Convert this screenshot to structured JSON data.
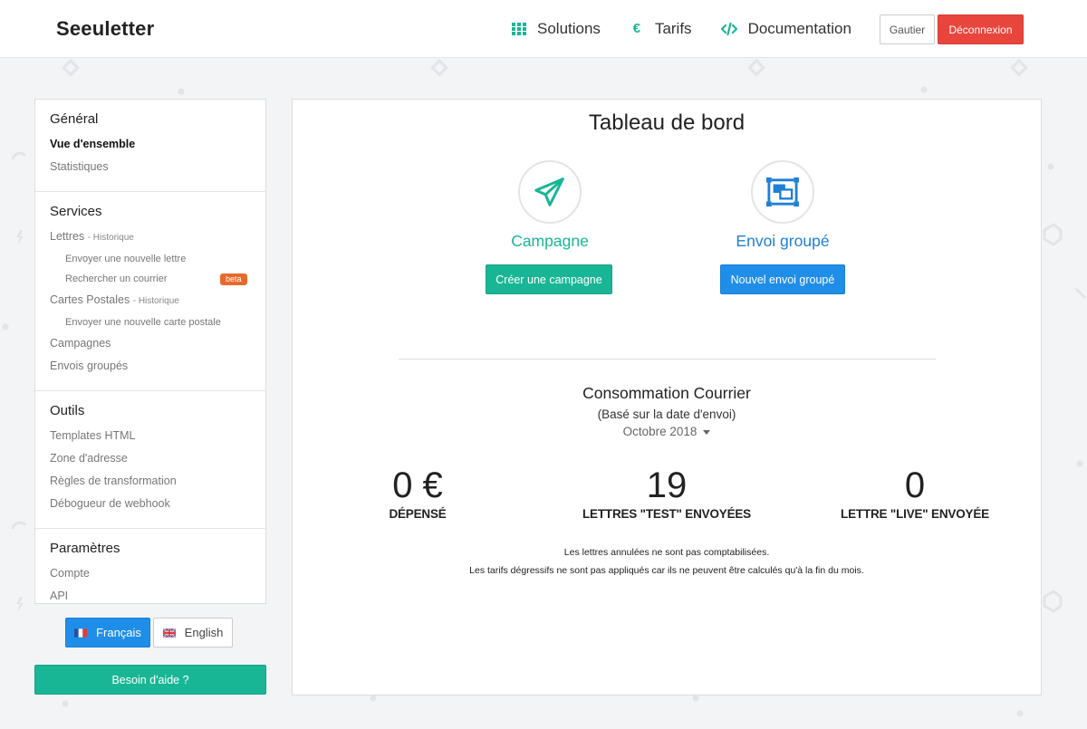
{
  "header": {
    "brand": "Seeuletter",
    "nav": [
      {
        "label": "Solutions",
        "icon": "grid-icon"
      },
      {
        "label": "Tarifs",
        "icon": "euro-icon"
      },
      {
        "label": "Documentation",
        "icon": "code-icon"
      }
    ],
    "user_button": "Gautier",
    "logout_button": "Déconnexion"
  },
  "sidebar": {
    "general": {
      "title": "Général",
      "items": [
        "Vue d'ensemble",
        "Statistiques"
      ]
    },
    "services": {
      "title": "Services",
      "lettres": {
        "label": "Lettres",
        "sub": "- Historique"
      },
      "lettres_children": [
        "Envoyer une nouvelle lettre",
        "Rechercher un courrier"
      ],
      "beta_badge": "beta",
      "cartes": {
        "label": "Cartes Postales",
        "sub": "- Historique"
      },
      "cartes_children": [
        "Envoyer une nouvelle carte postale"
      ],
      "items": [
        "Campagnes",
        "Envois groupés"
      ]
    },
    "outils": {
      "title": "Outils",
      "items": [
        "Templates HTML",
        "Zone d'adresse",
        "Règles de transformation",
        "Débogueur de webhook"
      ]
    },
    "parametres": {
      "title": "Paramètres",
      "items": [
        "Compte",
        "API"
      ]
    }
  },
  "languages": {
    "french": "Français",
    "english": "English"
  },
  "help_button": "Besoin d'aide ?",
  "dashboard": {
    "title": "Tableau de bord",
    "campaign": {
      "label": "Campagne",
      "button": "Créer une campagne",
      "color": "#19b696",
      "icon": "paper-plane-icon"
    },
    "bulk": {
      "label": "Envoi groupé",
      "button": "Nouvel envoi groupé",
      "color": "#1f8ee8",
      "icon": "bulk-send-icon"
    },
    "consumption": {
      "title": "Consommation Courrier",
      "subtitle": "(Basé sur la date d'envoi)",
      "month": "Octobre 2018"
    },
    "stats": [
      {
        "value": "0 €",
        "label": "DÉPENSÉ"
      },
      {
        "value": "19",
        "label": "LETTRES \"TEST\" ENVOYÉES"
      },
      {
        "value": "0",
        "label": "LETTRE \"LIVE\" ENVOYÉE"
      }
    ],
    "notes": [
      "Les lettres annulées ne sont pas comptabilisées.",
      "Les tarifs dégressifs ne sont pas appliqués car ils ne peuvent être calculés qu'à la fin du mois."
    ]
  }
}
